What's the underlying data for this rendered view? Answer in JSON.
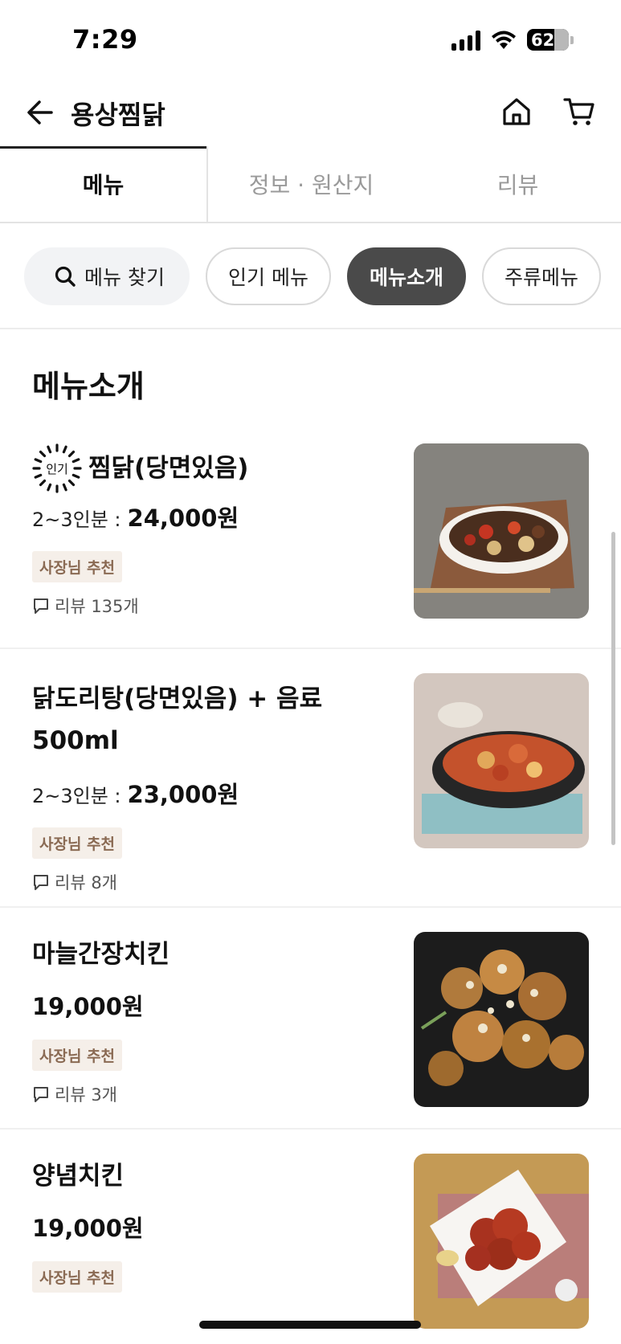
{
  "status_bar": {
    "time": "7:29",
    "battery": "62"
  },
  "header": {
    "title": "용상찜닭"
  },
  "tabs": [
    {
      "label": "메뉴",
      "active": true
    },
    {
      "label": "정보 · 원산지",
      "active": false
    },
    {
      "label": "리뷰",
      "active": false
    }
  ],
  "chips": {
    "search_label": "메뉴 찾기",
    "items": [
      {
        "label": "인기 메뉴",
        "active": false
      },
      {
        "label": "메뉴소개",
        "active": true
      },
      {
        "label": "주류메뉴",
        "active": false
      }
    ]
  },
  "section": {
    "title": "메뉴소개"
  },
  "menu_items": [
    {
      "popular_label": "인기",
      "name": "찜닭(당면있음)",
      "price_prefix": "2~3인분 :",
      "price": "24,000원",
      "badge": "사장님 추천",
      "review": "리뷰 135개"
    },
    {
      "name": "닭도리탕(당면있음) + 음료 500ml",
      "price_prefix": "2~3인분 :",
      "price": "23,000원",
      "badge": "사장님 추천",
      "review": "리뷰 8개"
    },
    {
      "name": "마늘간장치킨",
      "price": "19,000원",
      "badge": "사장님 추천",
      "review": "리뷰 3개"
    },
    {
      "name": "양념치킨",
      "price": "19,000원",
      "badge": "사장님 추천"
    }
  ],
  "colors": {
    "accent_dark": "#4a4a4a",
    "badge_bg": "#f5efe9",
    "badge_text": "#8a6a53"
  }
}
